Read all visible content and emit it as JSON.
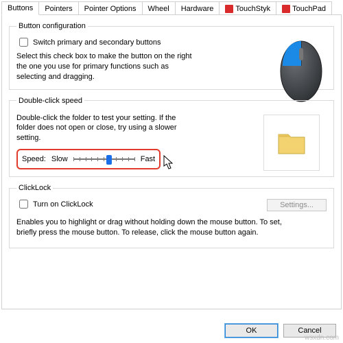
{
  "tabs": {
    "buttons": "Buttons",
    "pointers": "Pointers",
    "pointer_options": "Pointer Options",
    "wheel": "Wheel",
    "hardware": "Hardware",
    "touchstyk": "TouchStyk",
    "touchpad": "TouchPad"
  },
  "button_config": {
    "legend": "Button configuration",
    "switch_label": "Switch primary and secondary buttons",
    "desc": "Select this check box to make the button on the right the one you use for primary functions such as selecting and dragging."
  },
  "double_click": {
    "legend": "Double-click speed",
    "desc": "Double-click the folder to test your setting. If the folder does not open or close, try using a slower setting.",
    "speed_label": "Speed:",
    "slow": "Slow",
    "fast": "Fast"
  },
  "clicklock": {
    "legend": "ClickLock",
    "turn_on": "Turn on ClickLock",
    "settings": "Settings...",
    "desc": "Enables you to highlight or drag without holding down the mouse button. To set, briefly press the mouse button. To release, click the mouse button again."
  },
  "buttons_bottom": {
    "ok": "OK",
    "cancel": "Cancel"
  },
  "watermark": "wsxdn.com"
}
